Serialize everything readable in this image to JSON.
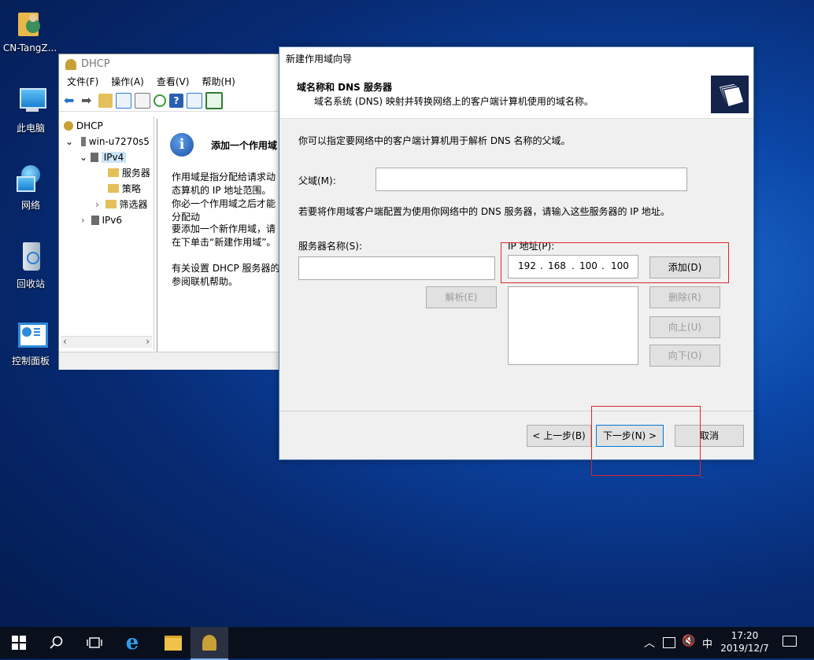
{
  "desktop": {
    "icons": [
      {
        "label": "CN-TangZ..."
      },
      {
        "label": "此电脑"
      },
      {
        "label": "网络"
      },
      {
        "label": "回收站"
      },
      {
        "label": "控制面板"
      }
    ]
  },
  "dhcp_console": {
    "title": "DHCP",
    "menu": [
      "文件(F)",
      "操作(A)",
      "查看(V)",
      "帮助(H)"
    ],
    "tree": {
      "root": "DHCP",
      "server": "win-u7270s5",
      "ipv4": "IPv4",
      "children": [
        "服务器",
        "策略",
        "筛选器"
      ],
      "ipv6": "IPv6"
    },
    "info_title": "添加一个作用域",
    "info_paragraphs": [
      "作用域是指分配给请求动态算机的 IP 地址范围。你必一个作用域之后才能分配动",
      "要添加一个新作用域，请在下单击“新建作用域”。",
      "有关设置 DHCP 服务器的参阅联机帮助。"
    ]
  },
  "wizard": {
    "title": "新建作用域向导",
    "header_title": "域名称和 DNS 服务器",
    "header_subtitle": "域名系统 (DNS) 映射并转换网络上的客户端计算机使用的域名称。",
    "intro": "你可以指定要网络中的客户端计算机用于解析 DNS 名称的父域。",
    "parent_domain_label": "父域(M):",
    "parent_domain_value": "",
    "dns_instruction": "若要将作用域客户端配置为使用你网络中的 DNS 服务器，请输入这些服务器的 IP 地址。",
    "server_name_label": "服务器名称(S):",
    "server_name_value": "",
    "ip_label": "IP 地址(P):",
    "ip_octets": [
      "192",
      "168",
      "100",
      "100"
    ],
    "buttons": {
      "resolve": "解析(E)",
      "add": "添加(D)",
      "remove": "删除(R)",
      "up": "向上(U)",
      "down": "向下(O)",
      "back": "< 上一步(B)",
      "next": "下一步(N) >",
      "cancel": "取消"
    }
  },
  "taskbar": {
    "time": "17:20",
    "date": "2019/12/7",
    "ime": "中"
  },
  "colors": {
    "highlight_box": "#d9262b",
    "taskbar": "#0a0f1c"
  }
}
